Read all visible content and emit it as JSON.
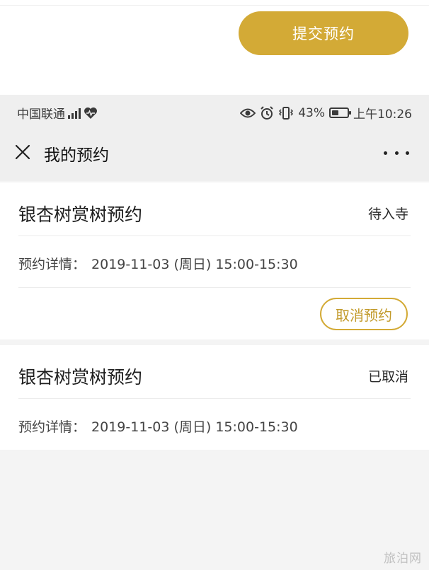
{
  "top_area": {
    "submit_label": "提交预约"
  },
  "status_bar": {
    "carrier": "中国联通",
    "battery_percent": "43%",
    "battery_level": 0.43,
    "time": "上午10:26"
  },
  "nav": {
    "title": "我的预约"
  },
  "reservations": [
    {
      "title": "银杏树赏树预约",
      "status": "待入寺",
      "detail_label": "预约详情：",
      "detail_value": "2019-11-03 (周日) 15:00-15:30",
      "action_label": "取消预约"
    },
    {
      "title": "银杏树赏树预约",
      "status": "已取消",
      "detail_label": "预约详情：",
      "detail_value": "2019-11-03 (周日) 15:00-15:30"
    }
  ],
  "watermark": "旅泊网",
  "colors": {
    "accent": "#d3aa36",
    "background": "#f4f4f4",
    "card": "#ffffff"
  }
}
